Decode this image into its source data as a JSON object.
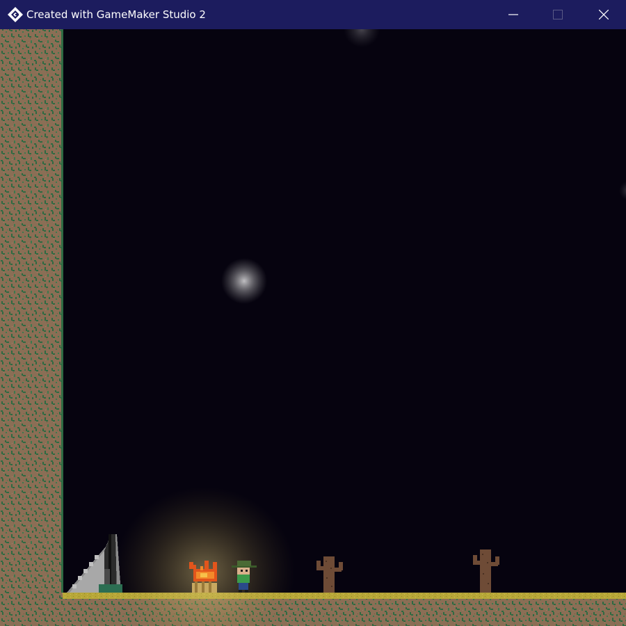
{
  "window": {
    "title": "Created with GameMaker Studio 2",
    "app_icon": "gamemaker-logo-icon",
    "controls": [
      "minimize-icon",
      "maximize-icon",
      "close-icon"
    ]
  },
  "colors": {
    "titlebar": "#1c1c5e",
    "sky": "#06030f",
    "dirt": "#8b6e55",
    "moss": "#2e6a42",
    "sand": "#b7a738",
    "campfire_glow": "#f1d98a",
    "cactus": "#6e4b36",
    "fire": "#e2551c"
  },
  "scene": {
    "entities": [
      "player",
      "campfire",
      "tent",
      "cactus",
      "cactus",
      "light-orb",
      "light-orb",
      "light-orb"
    ]
  }
}
